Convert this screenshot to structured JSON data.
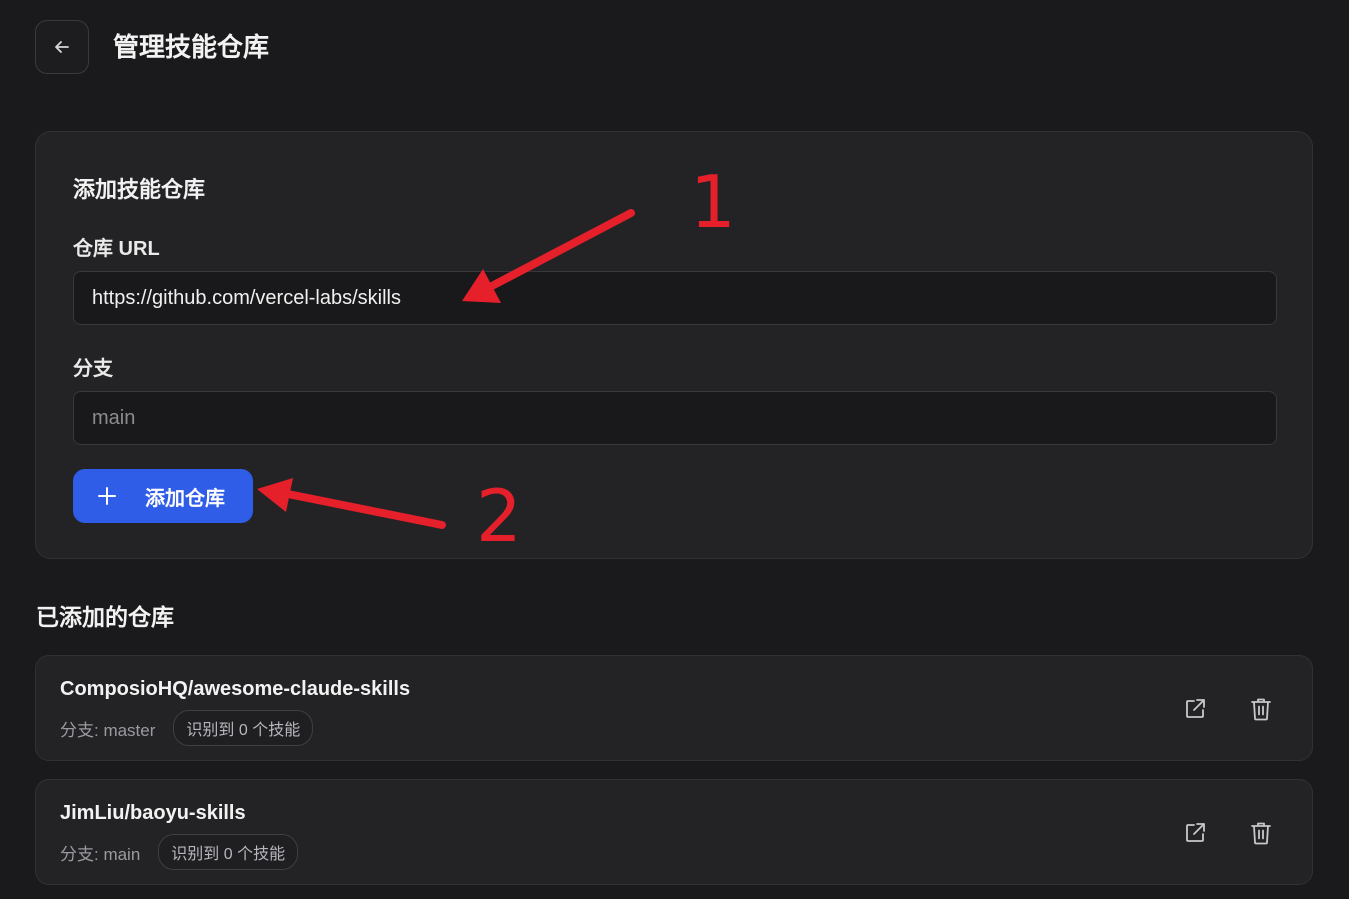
{
  "header": {
    "back_icon": "arrow-left-icon",
    "title": "管理技能仓库"
  },
  "add_form": {
    "title": "添加技能仓库",
    "url_label": "仓库 URL",
    "url_value": "https://github.com/vercel-labs/skills",
    "branch_label": "分支",
    "branch_placeholder": "main",
    "add_button_label": "添加仓库",
    "add_button_icon": "plus-icon",
    "accent_color": "#2f5de8"
  },
  "repos_section": {
    "title": "已添加的仓库",
    "items": [
      {
        "name": "ComposioHQ/awesome-claude-skills",
        "branch": "分支: master",
        "skills_badge": "识别到 0 个技能",
        "open_icon": "external-link-icon",
        "delete_icon": "trash-icon"
      },
      {
        "name": "JimLiu/baoyu-skills",
        "branch": "分支: main",
        "skills_badge": "识别到 0 个技能",
        "open_icon": "external-link-icon",
        "delete_icon": "trash-icon"
      }
    ]
  },
  "annotations": {
    "color": "#e5202a",
    "labels": [
      "1",
      "2"
    ]
  }
}
